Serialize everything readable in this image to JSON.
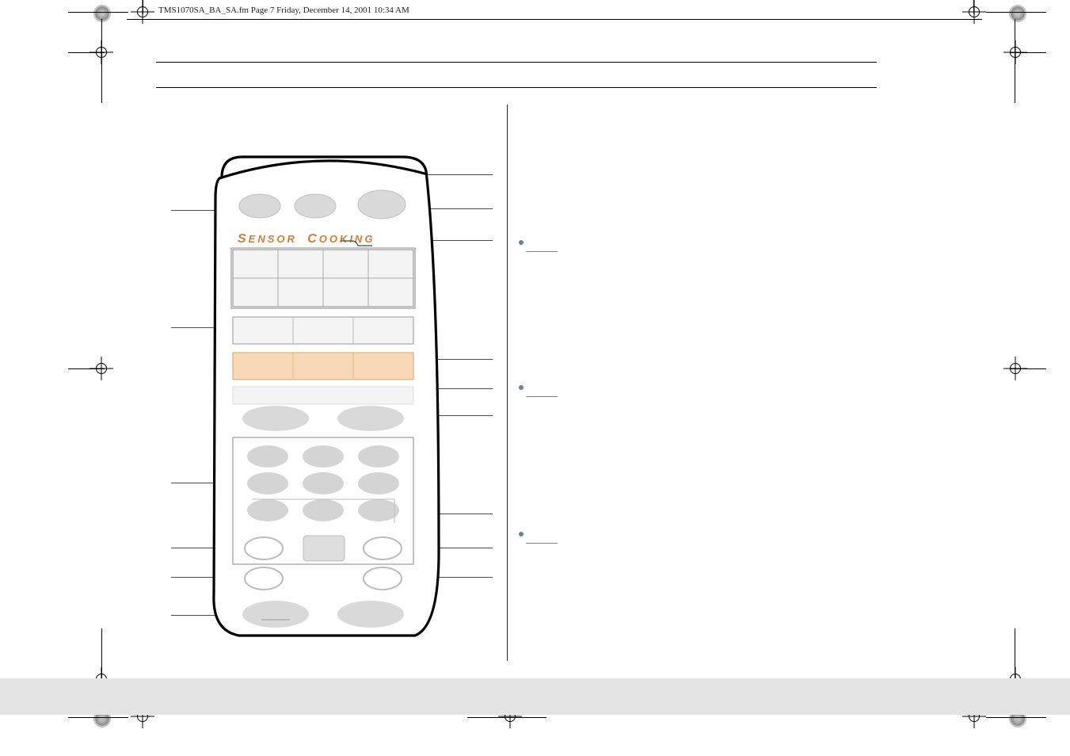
{
  "header": {
    "filename_line": "TMS1070SA_BA_SA.fm  Page 7  Friday, December 14, 2001  10:34 AM"
  },
  "panel": {
    "sensor_heading_cap1": "S",
    "sensor_heading_word1": "ENSOR",
    "sensor_heading_cap2": "C",
    "sensor_heading_word2": "OOKING"
  }
}
